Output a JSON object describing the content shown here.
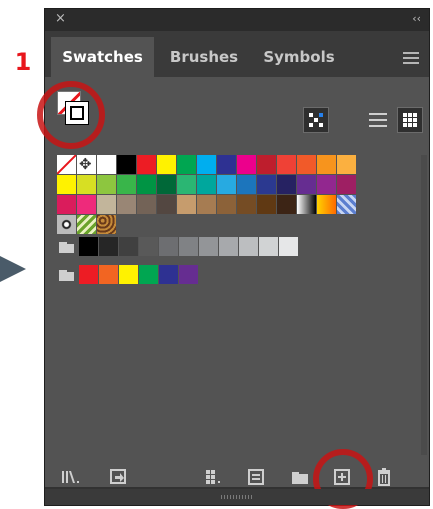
{
  "annotation": {
    "step_number": "1"
  },
  "panel": {
    "title_bar": {
      "close_glyph": "×",
      "collapse_glyph": "‹‹"
    },
    "tabs": [
      {
        "label": "Swatches",
        "active": true
      },
      {
        "label": "Brushes",
        "active": false
      },
      {
        "label": "Symbols",
        "active": false
      }
    ],
    "menu_icon": "hamburger-menu-icon",
    "colors": {
      "panel_bg": "#535353",
      "tab_bar": "#3a3a3a",
      "highlight_ring": "#c81414",
      "accent_blue": "#2680eb"
    },
    "swatch_rows": [
      [
        "none",
        "registration",
        "#ffffff",
        "#000000",
        "#ed1c24",
        "#fff200",
        "#00a651",
        "#00aeef",
        "#2e3192",
        "#ec008c",
        "#be1e2d",
        "#ef4136",
        "#f15a29",
        "#f7941d",
        "#fbb040"
      ],
      [
        "#fff200",
        "#d7df23",
        "#8dc63f",
        "#39b54a",
        "#009444",
        "#006838",
        "#2bb673",
        "#00a79d",
        "#27aae1",
        "#1c75bc",
        "#2b3990",
        "#262262",
        "#662d91",
        "#92278f",
        "#9e1f63"
      ],
      [
        "#da1c5c",
        "#ee2a7b",
        "#c2b59b",
        "#998675",
        "#736357",
        "#534741",
        "#c69c6d",
        "#a67c52",
        "#8c6239",
        "#754c24",
        "#603913",
        "#3c2415",
        "gray-grad",
        "orange-grad",
        "blue-grad"
      ],
      [
        "pattern1",
        "pattern2",
        "pattern3"
      ],
      [
        "folder",
        "#000000",
        "#262626",
        "#404040",
        "#595959",
        "#6d6e71",
        "#808285",
        "#939598",
        "#a7a9ac",
        "#bcbec0",
        "#d1d3d4",
        "#e6e7e8"
      ],
      [
        "folder",
        "#ed1c24",
        "#f26522",
        "#fff200",
        "#00a651",
        "#2e3192",
        "#662d91"
      ]
    ],
    "bottom_icons": [
      "swatch-libraries-icon",
      "show-kinds-icon",
      "swatch-options-icon",
      "color-group-icon",
      "new-folder-icon",
      "new-swatch-icon",
      "delete-icon"
    ]
  }
}
